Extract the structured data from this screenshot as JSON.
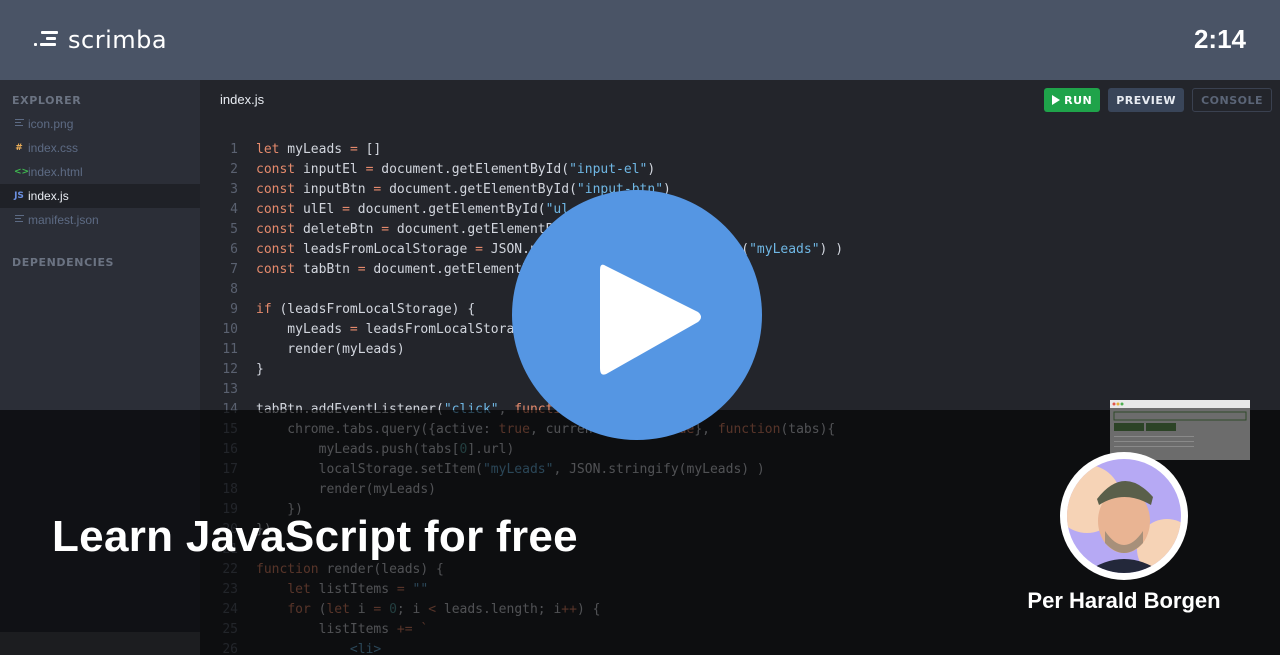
{
  "header": {
    "logo_text": "scrimba",
    "timer": "2:14"
  },
  "sidebar": {
    "explorer_label": "EXPLORER",
    "dependencies_label": "DEPENDENCIES",
    "files": [
      {
        "name": "icon.png",
        "icon": "file-lines-icon",
        "active": false
      },
      {
        "name": "index.css",
        "icon": "hash-icon",
        "active": false
      },
      {
        "name": "index.html",
        "icon": "code-brackets-icon",
        "active": false
      },
      {
        "name": "index.js",
        "icon": "js-icon",
        "active": true
      },
      {
        "name": "manifest.json",
        "icon": "file-lines-icon",
        "active": false
      }
    ]
  },
  "editor": {
    "tab_title": "index.js",
    "toolbar": {
      "run_label": "RUN",
      "preview_label": "PREVIEW",
      "console_label": "CONSOLE"
    },
    "line_numbers": [
      "1",
      "2",
      "3",
      "4",
      "5",
      "6",
      "7",
      "8",
      "9",
      "10",
      "11",
      "12",
      "13",
      "14",
      "15",
      "16",
      "17",
      "18",
      "19",
      "20",
      "21",
      "22",
      "23",
      "24",
      "25",
      "26"
    ],
    "code_lines": [
      "let myLeads = []",
      "const inputEl = document.getElementById(\"input-el\")",
      "const inputBtn = document.getElementById(\"input-btn\")",
      "const ulEl = document.getElementById(\"ul-el\")",
      "const deleteBtn = document.getElementById(\"delete-btn\")",
      "const leadsFromLocalStorage = JSON.parse( localStorage.getItem(\"myLeads\") )",
      "const tabBtn = document.getElementById(\"tab-btn\")",
      "",
      "if (leadsFromLocalStorage) {",
      "    myLeads = leadsFromLocalStorage",
      "    render(myLeads)",
      "}",
      "",
      "tabBtn.addEventListener(\"click\", function(){",
      "    chrome.tabs.query({active: true, currentWindow: true}, function(tabs){",
      "        myLeads.push(tabs[0].url)",
      "        localStorage.setItem(\"myLeads\", JSON.stringify(myLeads) )",
      "        render(myLeads)",
      "    })",
      "})",
      "",
      "function render(leads) {",
      "    let listItems = \"\"",
      "    for (let i = 0; i < leads.length; i++) {",
      "        listItems += `",
      "            <li>"
    ]
  },
  "overlay": {
    "headline": "Learn JavaScript for free",
    "instructor_name": "Per Harald Borgen"
  },
  "colors": {
    "header_bg": "#4a5466",
    "sidebar_bg": "#2b2e37",
    "editor_bg": "#23252b",
    "run_green": "#1fa34a",
    "play_blue": "#5596e3",
    "keyword": "#e58a6c",
    "string": "#6fb7e4"
  }
}
